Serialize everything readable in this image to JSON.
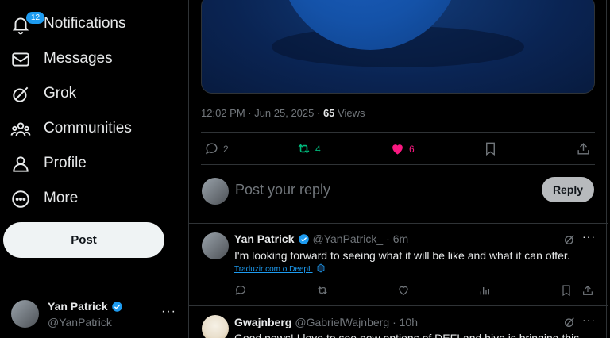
{
  "sidebar": {
    "items": [
      {
        "label": "Notifications",
        "icon": "bell-icon",
        "badge": "12"
      },
      {
        "label": "Messages",
        "icon": "mail-icon"
      },
      {
        "label": "Grok",
        "icon": "grok-icon"
      },
      {
        "label": "Communities",
        "icon": "communities-icon"
      },
      {
        "label": "Profile",
        "icon": "person-icon"
      },
      {
        "label": "More",
        "icon": "more-circle-icon"
      }
    ],
    "post_label": "Post",
    "account": {
      "name": "Yan Patrick",
      "handle": "@YanPatrick_",
      "more": "···"
    }
  },
  "post": {
    "time": "12:02 PM · Jun 25, 2025 · ",
    "views_count": "65",
    "views_label": " Views",
    "replies": "2",
    "reposts": "4",
    "likes": "6"
  },
  "compose": {
    "placeholder": "Post your reply",
    "reply_label": "Reply"
  },
  "replies": [
    {
      "name": "Yan Patrick",
      "handle": "@YanPatrick_",
      "time": "· 6m",
      "text": "I'm looking forward to seeing what it will be like and what it can offer.",
      "translate": "Traduzir com o DeepL"
    },
    {
      "name": "Gwajnberg",
      "handle": "@GabrielWajnberg",
      "time": "· 10h",
      "text": "Good news! I love to see new options of DEFI and hive is bringing this"
    }
  ],
  "colors": {
    "accent": "#1d9bf0",
    "repost": "#00ba7c",
    "like": "#f91880",
    "background": "#000000"
  }
}
